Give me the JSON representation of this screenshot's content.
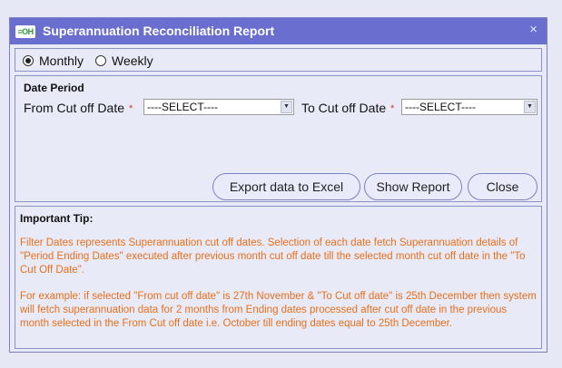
{
  "window": {
    "logo_text": "≡OH",
    "title": "Superannuation Reconciliation Report",
    "close_glyph": "×"
  },
  "frequency": {
    "options": [
      {
        "label": "Monthly",
        "selected": true
      },
      {
        "label": "Weekly",
        "selected": false
      }
    ]
  },
  "filters": {
    "section_label": "Date Period",
    "from_label": "From Cut off Date",
    "from_required": "*",
    "from_value": "----SELECT----",
    "to_label": "To Cut off Date",
    "to_required": "*",
    "to_value": "----SELECT----",
    "dropdown_arrow": "▼"
  },
  "buttons": {
    "export": "Export data to Excel",
    "show": "Show Report",
    "close": "Close"
  },
  "tip": {
    "title": "Important Tip:",
    "paragraph1": "Filter Dates represents Superannuation cut off dates. Selection of each date fetch Superannuation details of \"Period Ending Dates\" executed after previous month cut off date till the selected month cut off date in the \"To Cut Off Date\".",
    "paragraph2": "For example: if selected \"From cut off date\" is 27th November & \"To Cut off date\" is 25th December then system will fetch superannuation data for 2 months from Ending dates processed after cut off date in the previous month selected in the From Cut off date i.e. October till ending dates equal to 25th December."
  },
  "colors": {
    "titlebar": "#6a6fcf",
    "tip_text": "#e8701a",
    "required": "#e0332b"
  }
}
